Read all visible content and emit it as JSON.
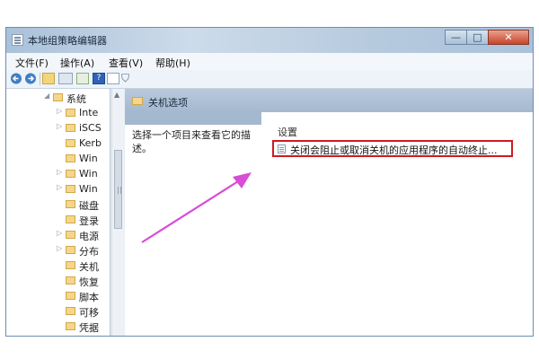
{
  "window": {
    "title": "本地组策略编辑器",
    "controls": {
      "minimize": "—",
      "maximize": "□",
      "close": "✕"
    }
  },
  "menu": [
    {
      "label": "文件(F)"
    },
    {
      "label": "操作(A)"
    },
    {
      "label": "查看(V)"
    },
    {
      "label": "帮助(H)"
    }
  ],
  "toolbar_icons": [
    "back-arrow-icon",
    "forward-arrow-icon",
    "up-folder-icon",
    "show-hide-tree-icon",
    "export-list-icon",
    "help-icon",
    "properties-icon",
    "filter-icon"
  ],
  "tree": {
    "items": [
      {
        "label": "系统",
        "expander": "◢"
      },
      {
        "label": "Inte",
        "expander": "▷"
      },
      {
        "label": "iSCS",
        "expander": "▷"
      },
      {
        "label": "Kerb",
        "expander": ""
      },
      {
        "label": "Win",
        "expander": ""
      },
      {
        "label": "Win",
        "expander": "▷"
      },
      {
        "label": "Win",
        "expander": "▷"
      },
      {
        "label": "磁盘",
        "expander": ""
      },
      {
        "label": "登录",
        "expander": ""
      },
      {
        "label": "电源",
        "expander": "▷"
      },
      {
        "label": "分布",
        "expander": "▷"
      },
      {
        "label": "关机",
        "expander": ""
      },
      {
        "label": "恢复",
        "expander": ""
      },
      {
        "label": "脚本",
        "expander": ""
      },
      {
        "label": "可移",
        "expander": ""
      },
      {
        "label": "凭据",
        "expander": ""
      }
    ],
    "scroll_arrow": "▲"
  },
  "right_panel": {
    "header": "关机选项",
    "description": "选择一个项目来查看它的描述。",
    "column_header": "设置",
    "policy_item": "关闭会阻止或取消关机的应用程序的自动终止..."
  },
  "colors": {
    "highlight_border": "#cf1a24",
    "annotation_arrow": "#d84cd8",
    "title_bar": "#b6cade"
  }
}
